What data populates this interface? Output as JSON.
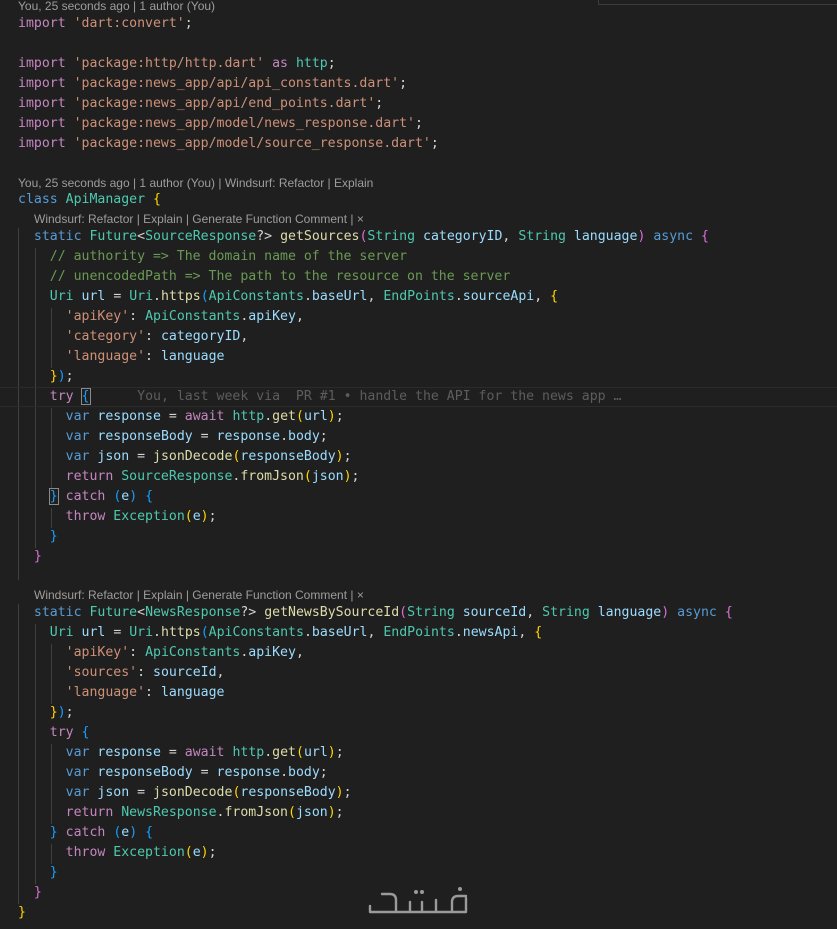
{
  "editor": {
    "codelens": {
      "imports_blame": "You, 25 seconds ago | 1 author (You)",
      "class_blame": "You, 25 seconds ago | 1 author (You) | Windsurf: Refactor | Explain",
      "method1": "Windsurf: Refactor | Explain | Generate Function Comment |",
      "method2": "Windsurf: Refactor | Explain | Generate Function Comment |",
      "close_glyph": "×"
    },
    "inline_blame": "You, last week via  PR #1 • handle the API for the news app …",
    "tokens": {
      "import": "import",
      "as": "as",
      "http": "http",
      "class": "class",
      "static": "static",
      "async": "async",
      "try": "try",
      "catch": "catch",
      "throw": "throw",
      "return": "return",
      "var": "var",
      "await": "await",
      "dart_convert": "'dart:convert'",
      "pkg_http": "'package:http/http.dart'",
      "pkg_api_constants": "'package:news_app/api/api_constants.dart'",
      "pkg_end_points": "'package:news_app/api/end_points.dart'",
      "pkg_news_response": "'package:news_app/model/news_response.dart'",
      "pkg_source_response": "'package:news_app/model/source_response.dart'",
      "ApiManager": "ApiManager",
      "Future": "Future",
      "SourceResponse": "SourceResponse",
      "NewsResponse": "NewsResponse",
      "getSources": "getSources",
      "getNewsBySourceId": "getNewsBySourceId",
      "String": "String",
      "categoryID": "categoryID",
      "sourceId": "sourceId",
      "language": "language",
      "cmt_authority": "// authority => The domain name of the server",
      "cmt_path": "// unencodedPath => The path to the resource on the server",
      "Uri": "Uri",
      "url": "url",
      "https": "https",
      "ApiConstants": "ApiConstants",
      "baseUrl": "baseUrl",
      "EndPoints": "EndPoints",
      "sourceApi": "sourceApi",
      "newsApi": "newsApi",
      "apiKey_str": "'apiKey'",
      "apiKey": "apiKey",
      "category_str": "'category'",
      "language_str": "'language'",
      "sources_str": "'sources'",
      "response": "response",
      "get": "get",
      "responseBody": "responseBody",
      "body": "body",
      "json": "json",
      "jsonDecode": "jsonDecode",
      "fromJson": "fromJson",
      "e": "e",
      "Exception": "Exception"
    },
    "watermark": "خمسات"
  }
}
